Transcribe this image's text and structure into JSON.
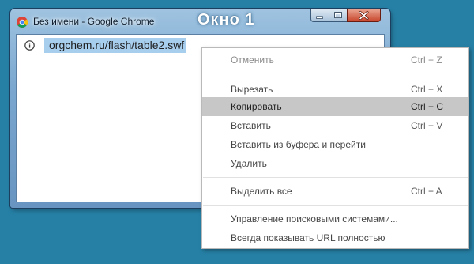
{
  "window": {
    "title": "Без имени - Google Chrome",
    "label": "Окно 1",
    "controls": [
      "minimize-icon",
      "maximize-icon",
      "close-icon"
    ]
  },
  "omnibox": {
    "icon": "info-icon",
    "url": "orgchem.ru/flash/table2.swf"
  },
  "context_menu": {
    "items": [
      {
        "label": "Отменить",
        "shortcut": "Ctrl + Z",
        "disabled": true
      },
      {
        "label": "Вырезать",
        "shortcut": "Ctrl + X"
      },
      {
        "label": "Копировать",
        "shortcut": "Ctrl + C",
        "highlighted": true
      },
      {
        "label": "Вставить",
        "shortcut": "Ctrl + V"
      },
      {
        "label": "Вставить из буфера и перейти",
        "shortcut": ""
      },
      {
        "label": "Удалить",
        "shortcut": ""
      },
      {
        "label": "Выделить все",
        "shortcut": "Ctrl + A"
      },
      {
        "label": "Управление поисковыми системами...",
        "shortcut": ""
      },
      {
        "label": "Всегда показывать URL полностью",
        "shortcut": ""
      }
    ]
  },
  "colors": {
    "desktop": "#2680a6",
    "selection": "#a8ceee",
    "menu_highlight": "#c7c7c7"
  }
}
